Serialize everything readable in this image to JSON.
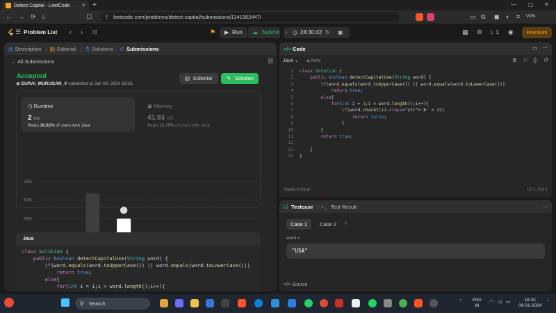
{
  "browser": {
    "tab_title": "Detect Capital - LeetCode",
    "url": "leetcode.com/problems/detect-capital/submissions/1141362447/",
    "vpn": "VPN"
  },
  "lcnav": {
    "problem_list": "Problem List",
    "run": "Run",
    "submit": "Submit",
    "timer": "24:30:42",
    "streak": "1",
    "premium": "Premium"
  },
  "left": {
    "tabs": [
      "Description",
      "Editorial",
      "Solutions",
      "Submissions"
    ],
    "all_submissions": "All Submissions",
    "status": "Accepted",
    "user": "DURAI_MURUGAN_V",
    "submitted_at": "submitted at Jan 09, 2024 16:31",
    "editorial_btn": "Editorial",
    "solution_btn": "Solution",
    "runtime": {
      "title": "Runtime",
      "value": "2",
      "unit": "ms",
      "beats_prefix": "Beats",
      "beats_pct": "36.82%",
      "beats_suffix": "of users with Java"
    },
    "memory": {
      "title": "Memory",
      "value": "41.93",
      "unit": "MB",
      "beats_prefix": "Beats",
      "beats_pct": "12.75%",
      "beats_suffix": "of users with Java"
    },
    "code_lang": "Java",
    "code_lines": [
      "class Solution {",
      "    public boolean detectCapitalUse(String word) {",
      "        if(word.equals(word.toUpperCase()) || word.equals(word.toLowerCase()))",
      "            return true;",
      "        else{",
      "            for(int i = 1;i < word.length();i++){",
      "                if(word.charAt(i)-'A' < 32)"
    ]
  },
  "chart_data": {
    "type": "bar",
    "title": "",
    "xlabel": "",
    "ylabel": "",
    "categories": [
      "0ms",
      "1ms",
      "2ms",
      "3ms",
      "4ms",
      "5ms",
      "6ms"
    ],
    "values": [
      4,
      59,
      25,
      2,
      2,
      2,
      2
    ],
    "highlight_index": 2,
    "ytick_labels": [
      "75%",
      "50%",
      "25%",
      "0%"
    ],
    "yticks": [
      75,
      50,
      25,
      0
    ],
    "ylim": [
      0,
      75
    ],
    "xtick_labels": [
      "",
      "1ms",
      "2ms",
      "3ms",
      "4ms",
      "5ms",
      "6ms"
    ]
  },
  "code": {
    "title": "Code",
    "lang": "Java",
    "mode": "Auto",
    "saved": "Saved to local",
    "cursor": "Ln 1, Col 1",
    "lines": [
      "class Solution {",
      "    public boolean detectCapitalUse(String word) {",
      "        if(word.equals(word.toUpperCase()) || word.equals(word.toLowerCase()))",
      "            return true;",
      "        else{",
      "            for(int i = 1;i < word.length();i++){",
      "                if(word.charAt(i)-'A' < 32)",
      "                    return false;",
      "                }",
      "        }",
      "        return true;",
      "",
      "    }",
      "}"
    ]
  },
  "testcase": {
    "tab_testcase": "Testcase",
    "tab_result": "Test Result",
    "case1": "Case 1",
    "case2": "Case 2",
    "add": "+",
    "var_label": "word =",
    "var_value": "\"USA\"",
    "source": "Source"
  },
  "taskbar": {
    "search": "Search",
    "lang_top": "ENG",
    "lang_bottom": "IN",
    "time": "16:33",
    "date": "09-01-2024"
  }
}
